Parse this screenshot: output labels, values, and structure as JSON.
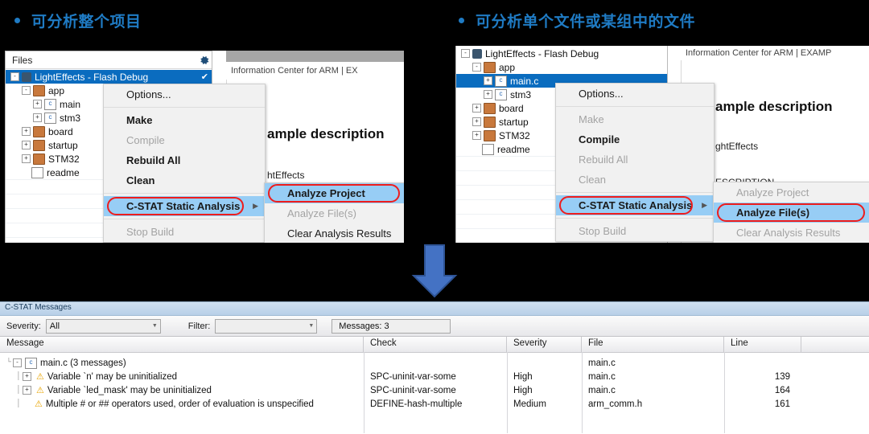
{
  "headings": {
    "left": "可分析整个项目",
    "right": "可分析单个文件或某组中的文件"
  },
  "left_shot": {
    "files_title": "Files",
    "gear_icon": "gear-icon",
    "tree": [
      {
        "label": "LightEffects - Flash Debug",
        "icon": "project-icon",
        "toggle": "-",
        "depth": 0,
        "selected": true,
        "check": "✔"
      },
      {
        "label": "app",
        "icon": "folder-icon",
        "toggle": "-",
        "depth": 1
      },
      {
        "label": "main",
        "icon": "c-file-icon",
        "toggle": "+",
        "depth": 2
      },
      {
        "label": "stm3",
        "icon": "c-file-icon",
        "toggle": "+",
        "depth": 2
      },
      {
        "label": "board",
        "icon": "folder-icon",
        "toggle": "+",
        "depth": 1
      },
      {
        "label": "startup",
        "icon": "folder-icon",
        "toggle": "+",
        "depth": 1
      },
      {
        "label": "STM32",
        "icon": "folder-icon",
        "toggle": "+",
        "depth": 1
      },
      {
        "label": "readme",
        "icon": "doc-icon",
        "toggle": "",
        "depth": 1
      }
    ],
    "tab_label": "Information Center for ARM | EX",
    "doc_title": "ample description",
    "doc_text": "htEffects",
    "menu": [
      {
        "label": "Options...",
        "state": "normal"
      },
      {
        "label": "sep"
      },
      {
        "label": "Make",
        "state": "bold"
      },
      {
        "label": "Compile",
        "state": "disabled"
      },
      {
        "label": "Rebuild All",
        "state": "bold"
      },
      {
        "label": "Clean",
        "state": "bold"
      },
      {
        "label": "sep"
      },
      {
        "label": "C-STAT Static Analysis",
        "state": "highlight",
        "submenu": true,
        "boxed": true
      },
      {
        "label": "sep"
      },
      {
        "label": "Stop Build",
        "state": "disabled"
      }
    ],
    "submenu": [
      {
        "label": "Analyze Project",
        "state": "highlight",
        "boxed": true
      },
      {
        "label": "Analyze File(s)",
        "state": "disabled"
      },
      {
        "label": "Clear Analysis Results",
        "state": "normal"
      }
    ]
  },
  "right_shot": {
    "tree": [
      {
        "label": "LightEffects - Flash Debug",
        "icon": "project-icon",
        "toggle": "-",
        "depth": 0,
        "check": "✔"
      },
      {
        "label": "app",
        "icon": "folder-icon",
        "toggle": "-",
        "depth": 1
      },
      {
        "label": "main.c",
        "icon": "c-file-icon",
        "toggle": "+",
        "depth": 2,
        "selected": true
      },
      {
        "label": "stm3",
        "icon": "c-file-icon",
        "toggle": "+",
        "depth": 2
      },
      {
        "label": "board",
        "icon": "folder-icon",
        "toggle": "+",
        "depth": 1
      },
      {
        "label": "startup",
        "icon": "folder-icon",
        "toggle": "+",
        "depth": 1
      },
      {
        "label": "STM32",
        "icon": "folder-icon",
        "toggle": "+",
        "depth": 1
      },
      {
        "label": "readme",
        "icon": "doc-icon",
        "toggle": "",
        "depth": 1
      }
    ],
    "tab_label": "Information Center for ARM | EXAMP",
    "doc_title": "ample description",
    "doc_text": "ghtEffects",
    "doc_section": "ESCRIPTION",
    "menu": [
      {
        "label": "Options...",
        "state": "normal"
      },
      {
        "label": "sep"
      },
      {
        "label": "Make",
        "state": "disabled"
      },
      {
        "label": "Compile",
        "state": "bold"
      },
      {
        "label": "Rebuild All",
        "state": "disabled"
      },
      {
        "label": "Clean",
        "state": "disabled"
      },
      {
        "label": "sep"
      },
      {
        "label": "C-STAT Static Analysis",
        "state": "highlight",
        "submenu": true,
        "boxed": true
      },
      {
        "label": "sep"
      },
      {
        "label": "Stop Build",
        "state": "disabled"
      }
    ],
    "submenu": [
      {
        "label": "Analyze Project",
        "state": "disabled"
      },
      {
        "label": "Analyze File(s)",
        "state": "highlight",
        "boxed": true
      },
      {
        "label": "Clear Analysis Results",
        "state": "disabled"
      }
    ]
  },
  "arrow": {
    "icon": "down-arrow-icon",
    "color": "#4472c4"
  },
  "cstat": {
    "title": "C-STAT Messages",
    "severity_label": "Severity:",
    "severity_value": "All",
    "filter_label": "Filter:",
    "filter_value": "",
    "messages_count": "Messages: 3",
    "columns": [
      "Message",
      "Check",
      "Severity",
      "File",
      "Line"
    ],
    "rows": [
      {
        "message": "main.c  (3 messages)",
        "icon": "c-file-icon",
        "toggle": "-",
        "depth": 0,
        "check": "",
        "severity": "",
        "file": "main.c",
        "line": ""
      },
      {
        "message": "Variable `n' may be uninitialized",
        "icon": "warning-icon",
        "toggle": "+",
        "depth": 1,
        "check": "SPC-uninit-var-some",
        "severity": "High",
        "file": "main.c",
        "line": "139"
      },
      {
        "message": "Variable `led_mask' may be uninitialized",
        "icon": "warning-icon",
        "toggle": "+",
        "depth": 1,
        "check": "SPC-uninit-var-some",
        "severity": "High",
        "file": "main.c",
        "line": "164"
      },
      {
        "message": "Multiple # or ## operators used, order of evaluation is unspecified",
        "icon": "warning-icon",
        "toggle": "",
        "depth": 1,
        "check": "DEFINE-hash-multiple",
        "severity": "Medium",
        "file": "arm_comm.h",
        "line": "161"
      }
    ]
  }
}
